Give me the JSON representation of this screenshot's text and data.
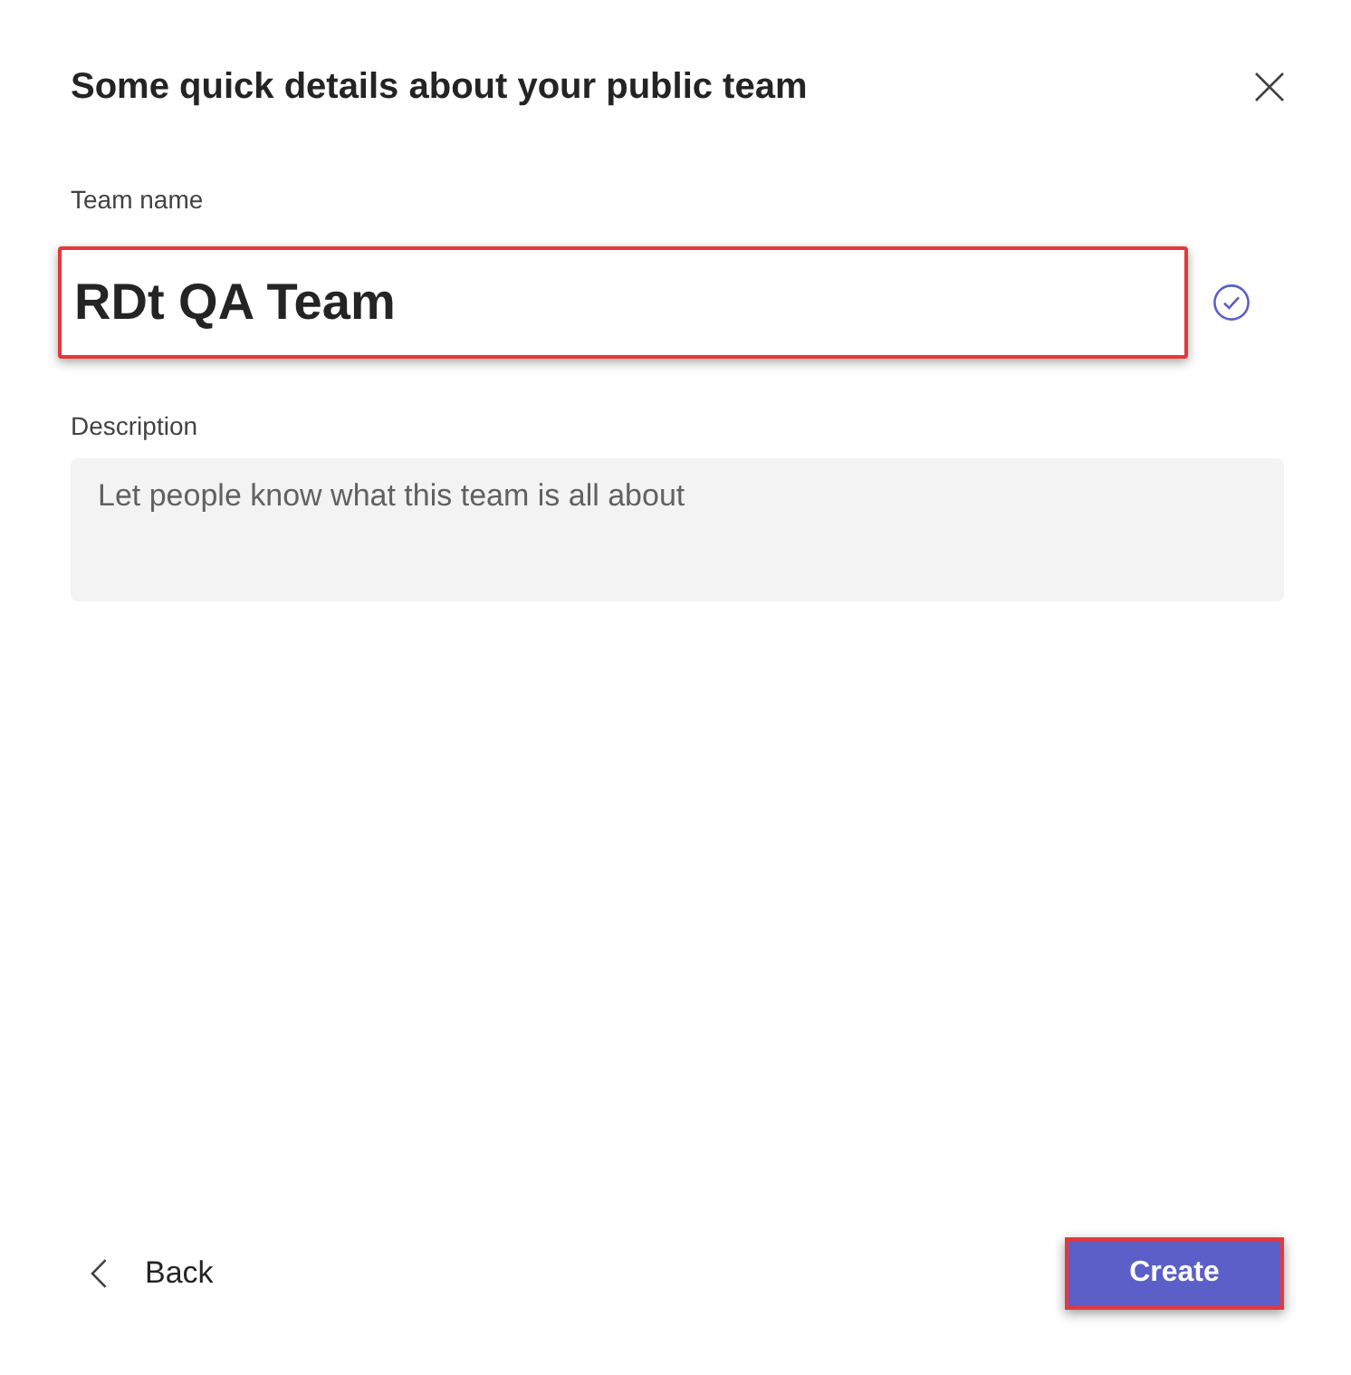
{
  "dialog": {
    "title": "Some quick details about your public team"
  },
  "team_name": {
    "label": "Team name",
    "value": "RDt QA Team",
    "highlighted": true,
    "valid": true
  },
  "description": {
    "label": "Description",
    "placeholder": "Let people know what this team is all about"
  },
  "footer": {
    "back_button": {
      "label": "Back"
    },
    "create_button": {
      "label": "Create",
      "highlighted": true
    }
  }
}
